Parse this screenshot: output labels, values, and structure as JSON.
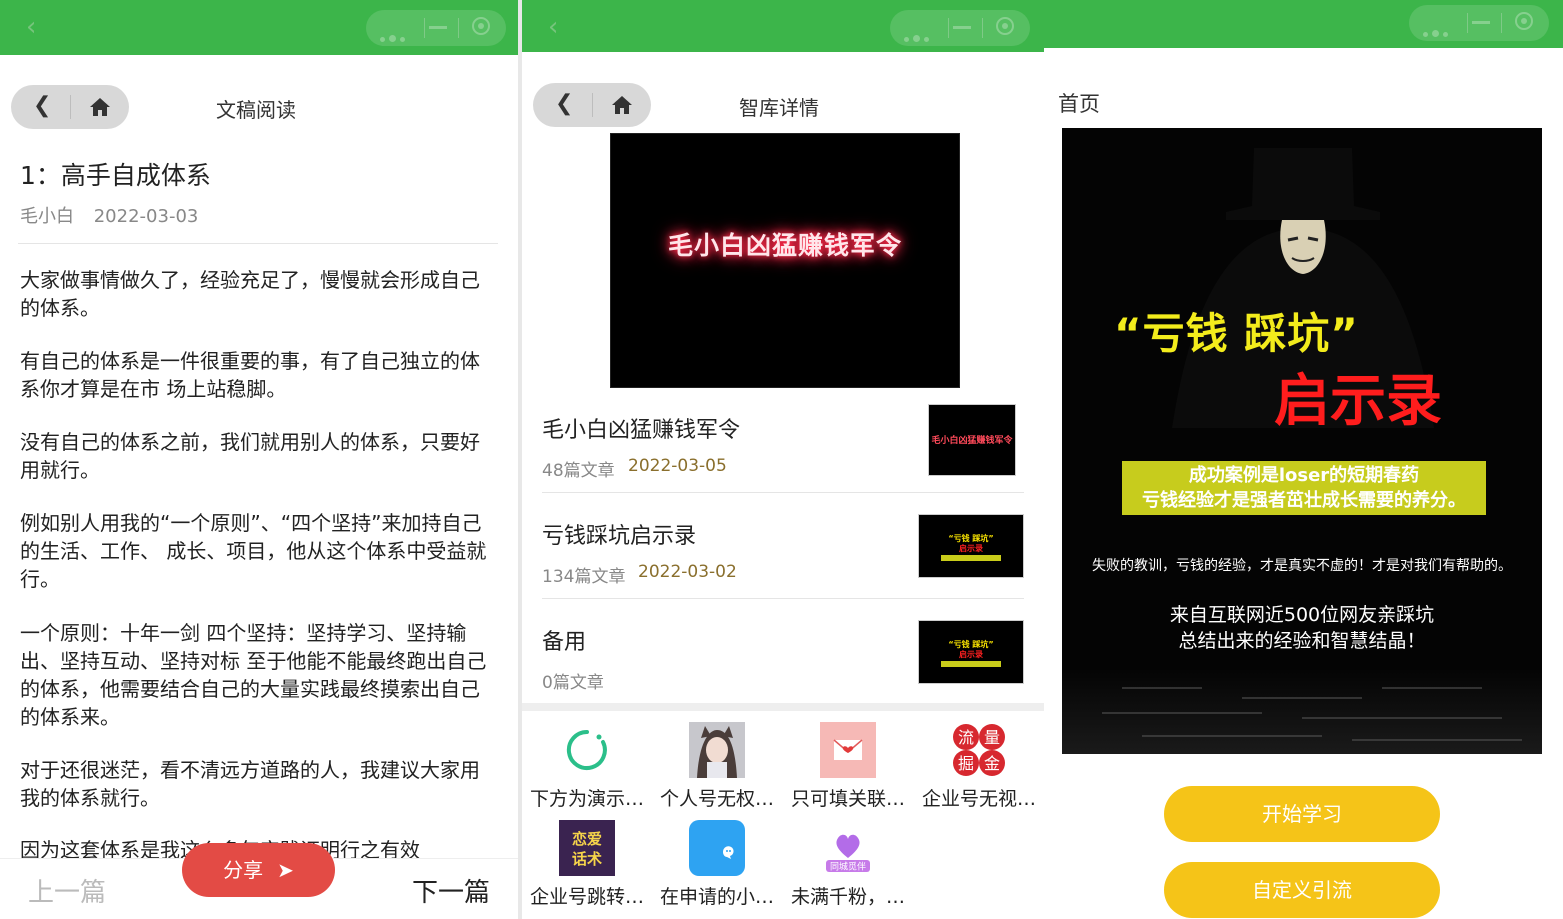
{
  "reader": {
    "nav_title": "文稿阅读",
    "title": "1：高手自成体系",
    "author": "毛小白",
    "date": "2022-03-03",
    "paragraphs": [
      "大家做事情做久了，经验充足了，慢慢就会形成自己的体系。",
      "有自己的体系是一件很重要的事，有了自己独立的体系你才算是在市 场上站稳脚。",
      "没有自己的体系之前，我们就用别人的体系，只要好用就行。",
      "例如别人用我的“一个原则”、“四个坚持”来加持自己的生活、工作、 成长、项目，他从这个体系中受益就行。",
      "一个原则：十年一剑 四个坚持：坚持学习、坚持输出、坚持互动、坚持对标 至于他能不能最终跑出自己的体系，他需要结合自己的大量实践最终摸索出自己的体系来。",
      "对于还很迷茫，看不清远方道路的人，我建议大家用我的体系就行。",
      "因为这套体系是我这么多年实践证明行之有效"
    ],
    "prev_label": "上一篇",
    "next_label": "下一篇",
    "share_label": "分享"
  },
  "library": {
    "nav_title": "智库详情",
    "cover_text": "毛小白凶猛赚钱军令",
    "items": [
      {
        "name": "毛小白凶猛赚钱军令",
        "count": "48篇文章",
        "date": "2022-03-05",
        "thumb_text": "毛小白凶猛赚钱军令"
      },
      {
        "name": "亏钱踩坑启示录",
        "count": "134篇文章",
        "date": "2022-03-02",
        "thumb_line1": "“亏钱 踩坑”",
        "thumb_line2": "启示录"
      },
      {
        "name": "备用",
        "count": "0篇文章",
        "date": "",
        "thumb_line1": "“亏钱 踩坑”",
        "thumb_line2": "启示录"
      }
    ],
    "apps": [
      {
        "label": "下方为演示…",
        "icon": "loading-circle-icon"
      },
      {
        "label": "个人号无权…",
        "icon": "anime-girl-avatar-icon"
      },
      {
        "label": "只可填关联…",
        "icon": "love-letter-icon"
      },
      {
        "label": "企业号无视…",
        "icon": "traffic-gold-icon",
        "icon_text": [
          "流",
          "量",
          "掘",
          "金"
        ]
      },
      {
        "label": "企业号跳转…",
        "icon": "love-talk-icon",
        "icon_text": [
          "恋爱",
          "话术"
        ]
      },
      {
        "label": "在申请的小…",
        "icon": "chat-bubble-icon"
      },
      {
        "label": "未满千粉，…",
        "icon": "heart-badge-icon",
        "icon_text": "同城觅伴"
      }
    ]
  },
  "home": {
    "title": "首页",
    "poster": {
      "quote": "“亏钱 踩坑”",
      "headline": "启示录",
      "band_line1": "成功案例是loser的短期春药",
      "band_line2": "亏钱经验才是强者茁壮成长需要的养分。",
      "small_text": "失败的教训，亏钱的经验，才是真实不虚的！才是对我们有帮助的。",
      "mid_line1": "来自互联网近500位网友亲踩坑",
      "mid_line2": "总结出来的经验和智慧结晶！"
    },
    "start_button": "开始学习",
    "custom_button": "自定义引流"
  },
  "colors": {
    "topbar": "#3cb54a",
    "share": "#e34b45",
    "yellow_button": "#f5c418",
    "date_brown": "#8a6f2d"
  }
}
